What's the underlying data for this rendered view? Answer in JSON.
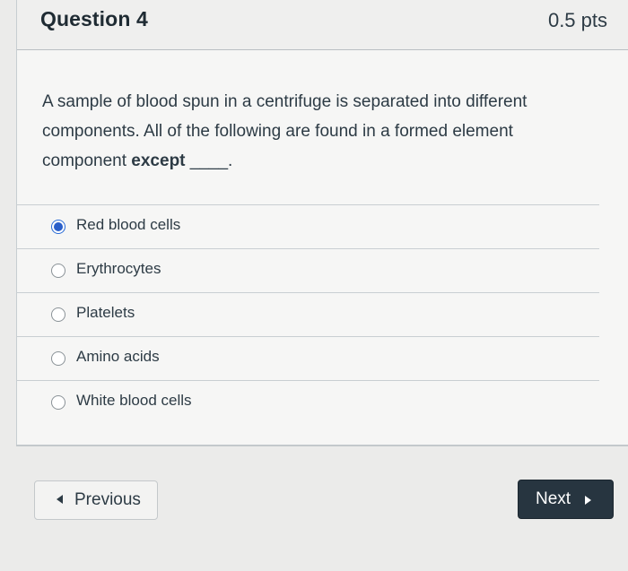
{
  "question": {
    "title": "Question 4",
    "points": "0.5 pts",
    "text_main": "A sample of blood spun in a centrifuge is separated into different components. All of the following are found in a formed element component ",
    "text_bold": "except",
    "text_blank": " ____."
  },
  "answers": [
    {
      "label": "Red blood cells",
      "selected": true
    },
    {
      "label": "Erythrocytes",
      "selected": false
    },
    {
      "label": "Platelets",
      "selected": false
    },
    {
      "label": "Amino acids",
      "selected": false
    },
    {
      "label": "White blood cells",
      "selected": false
    }
  ],
  "navigation": {
    "previous_label": "Previous",
    "next_label": "Next"
  },
  "colors": {
    "accent": "#2a5fc9",
    "next_button_bg": "#273540"
  }
}
